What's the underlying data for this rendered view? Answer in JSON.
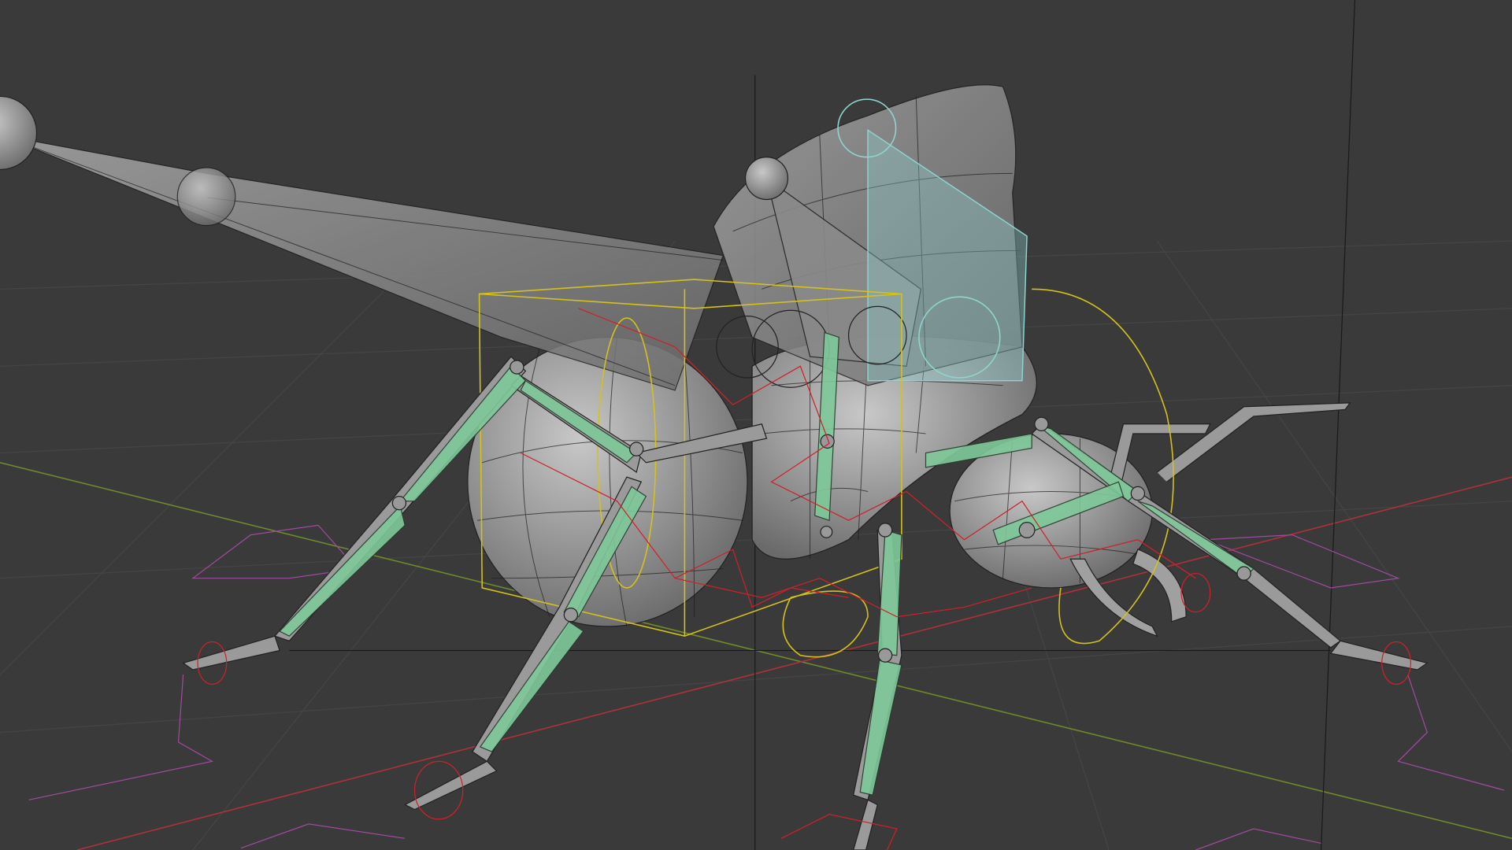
{
  "viewport": {
    "background": "#3a3a3a",
    "colors": {
      "grid": "#454545",
      "x_axis": "#b0303c",
      "y_axis": "#6e8a2a",
      "mesh": "#9a9a9a",
      "bone_deform": "#7fc99a",
      "bone_selected": "#8fd4d0",
      "control_red": "#d0202a",
      "control_yellow": "#d4c21a",
      "control_purple": "#a04aa0"
    }
  }
}
